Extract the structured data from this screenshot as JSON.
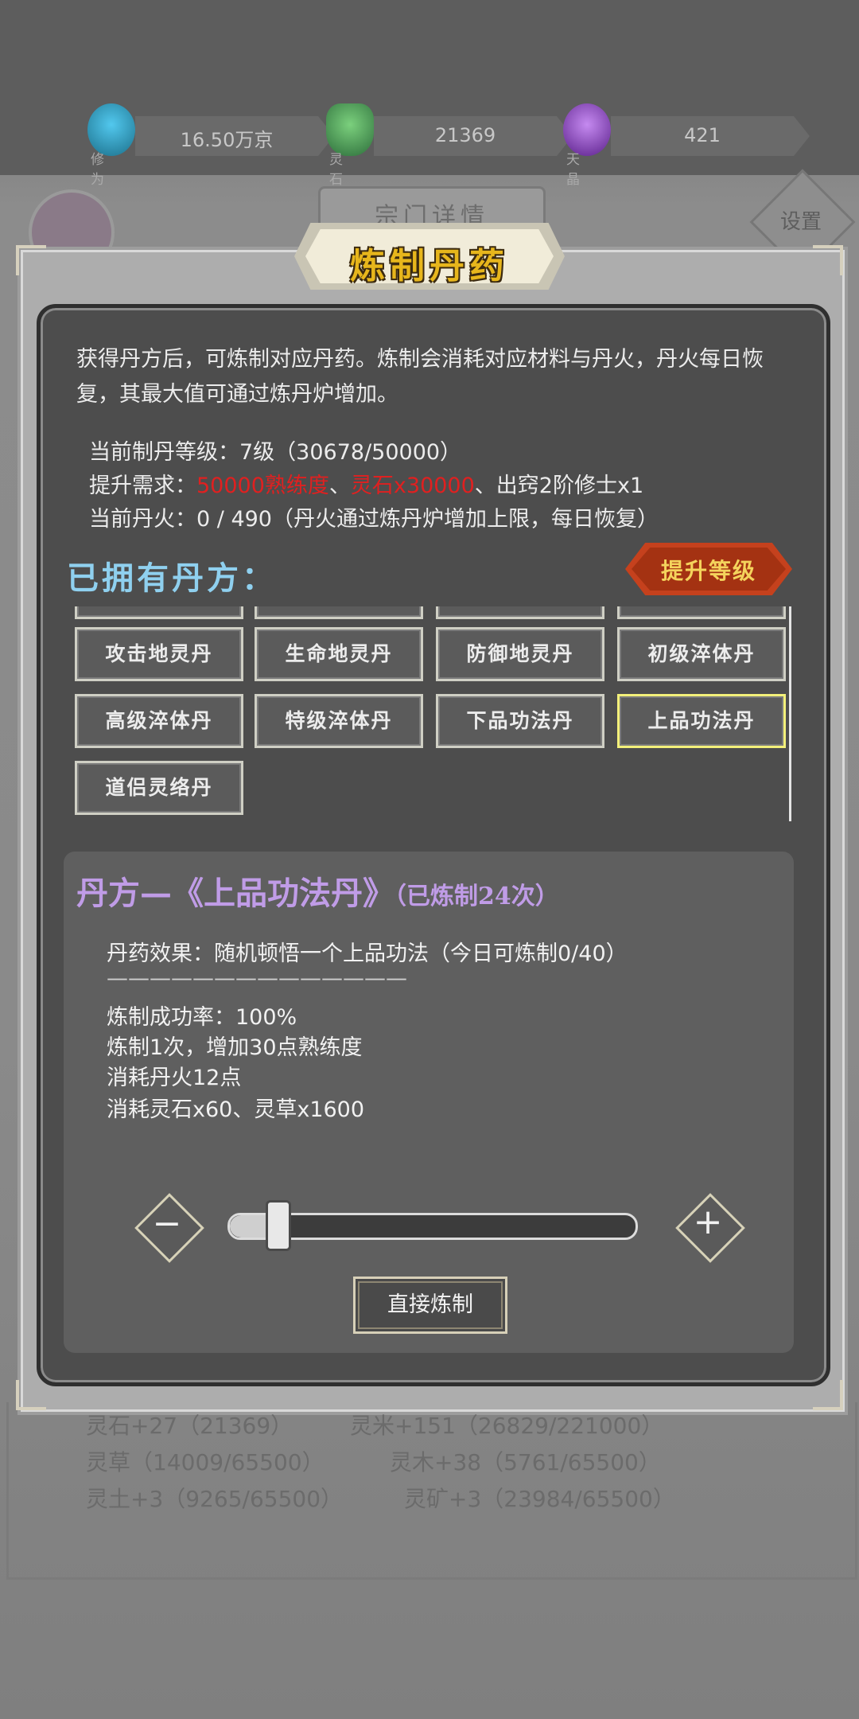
{
  "resources": [
    {
      "name": "修为",
      "value": "16.50万京",
      "color": "#2a9fc7",
      "icon": "soul-flame-icon"
    },
    {
      "name": "灵石",
      "value": "21369",
      "color": "#3f9a59",
      "icon": "spirit-stone-icon"
    },
    {
      "name": "天晶",
      "value": "421",
      "color": "#8b3fc4",
      "icon": "sky-crystal-icon"
    }
  ],
  "background": {
    "tab_label": "宗门详情",
    "settings_label": "设置"
  },
  "dialog": {
    "title": "炼制丹药",
    "description": "获得丹方后，可炼制对应丹药。炼制会消耗对应材料与丹火，丹火每日恢复，其最大值可通过炼丹炉增加。",
    "level_line": "当前制丹等级：7级（30678/50000）",
    "req_prefix": "提升需求：",
    "req_red1": "50000熟练度",
    "req_sep1": "、",
    "req_red2": "灵石x30000",
    "req_rest": "、出窍2阶修士x1",
    "fire_line": "当前丹火：0 / 490（丹火通过炼丹炉增加上限，每日恢复）",
    "owned_label": "已拥有丹方：",
    "upgrade_label": "提升等级",
    "recipes": [
      "攻击地灵丹",
      "生命地灵丹",
      "防御地灵丹",
      "初级淬体丹",
      "高级淬体丹",
      "特级淬体丹",
      "下品功法丹",
      "上品功法丹",
      "道侣灵络丹"
    ],
    "selected_index": 7
  },
  "detail": {
    "title_prefix": "丹方—《上品功法丹》",
    "crafted_count": "（已炼制24次）",
    "effect": "丹药效果：随机顿悟一个上品功法（今日可炼制0/40）",
    "divider": "——————————————",
    "success": "炼制成功率：100%",
    "proficiency": "炼制1次，增加30点熟练度",
    "fire_cost": "消耗丹火12点",
    "material_cost": "消耗灵石x60、灵草x1600",
    "slider_value_fraction": 0.05,
    "craft_button": "直接炼制"
  },
  "below_lines": [
    [
      "灵石+27（21369）",
      "灵米+151（26829/221000）"
    ],
    [
      "灵草（14009/65500）",
      "灵木+38（5761/65500）"
    ],
    [
      "灵土+3（9265/65500）",
      "灵矿+3（23984/65500）"
    ]
  ]
}
